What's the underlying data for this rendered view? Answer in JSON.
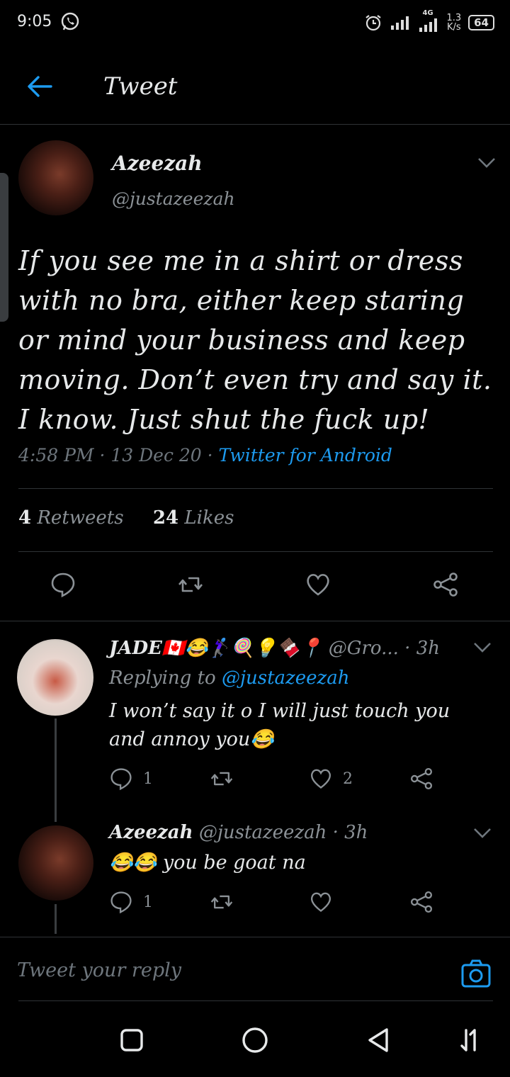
{
  "status": {
    "time": "9:05",
    "network": "4G",
    "speed_value": "1.3",
    "speed_unit": "K/s",
    "battery": "64"
  },
  "header": {
    "title": "Tweet"
  },
  "tweet": {
    "author_name": "Azeezah",
    "author_handle": "@justazeezah",
    "text": "If you see me in a shirt or dress with no bra, either keep staring or mind your business and keep moving. Don’t even try and say it. I know. Just shut the fuck up!",
    "meta_time": "4:58 PM · 13 Dec 20 · ",
    "meta_source": "Twitter for Android",
    "retweets_count": "4",
    "retweets_label": "Retweets",
    "likes_count": "24",
    "likes_label": "Likes"
  },
  "replies": [
    {
      "name": "JADE🇨🇦😂🏌🏿‍♀️🍭💡🍫📍",
      "handle_time": "@Gro... · 3h",
      "replying_label": "Replying to ",
      "replying_handle": "@justazeezah",
      "text": "I won’t say it o I will just touch you and annoy you😂",
      "reply_count": "1",
      "like_count": "2"
    },
    {
      "name": "Azeezah",
      "handle_time": "@justazeezah · 3h",
      "text": "😂😂 you be goat na",
      "reply_count": "1"
    }
  ],
  "compose": {
    "placeholder": "Tweet your reply"
  },
  "colors": {
    "accent": "#1d9bf0",
    "background": "#000000",
    "muted": "#8b9196"
  }
}
